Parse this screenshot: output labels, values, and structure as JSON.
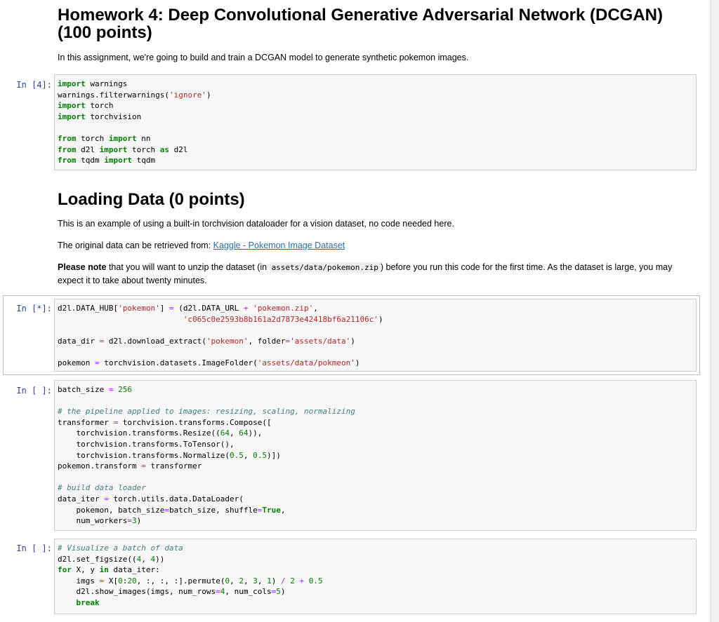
{
  "title": {
    "heading": "Homework 4: Deep Convolutional Generative Adversarial Network (DCGAN) (100 points)",
    "intro": "In this assignment, we're going to build and train a DCGAN model to generate synthetic pokemon images."
  },
  "loading": {
    "heading": "Loading Data (0 points)",
    "p1": "This is an example of using a built-in torchvision dataloader for a vision dataset, no code needed here.",
    "p2_prefix": "The original data can be retrieved from: ",
    "p2_link": "Kaggle - Pokemon Image Dataset",
    "p3_bold": "Please note",
    "p3_a": " that you will want to unzip the dataset (in ",
    "p3_code": "assets/data/pokemon.zip",
    "p3_b": ") before you run this code for the first time. As the dataset is large, you may expect it to take about twenty minutes."
  },
  "cells": [
    {
      "prompt": "In [4]:",
      "lines": [
        [
          [
            "kw",
            "import"
          ],
          [
            "t",
            " warnings"
          ]
        ],
        [
          [
            "t",
            "warnings.filterwarnings("
          ],
          [
            "st",
            "'ignore'"
          ],
          [
            "t",
            ")"
          ]
        ],
        [
          [
            "kw",
            "import"
          ],
          [
            "t",
            " torch"
          ]
        ],
        [
          [
            "kw",
            "import"
          ],
          [
            "t",
            " torchvision"
          ]
        ],
        [],
        [
          [
            "kw",
            "from"
          ],
          [
            "t",
            " torch "
          ],
          [
            "kw",
            "import"
          ],
          [
            "t",
            " nn"
          ]
        ],
        [
          [
            "kw",
            "from"
          ],
          [
            "t",
            " d2l "
          ],
          [
            "kw",
            "import"
          ],
          [
            "t",
            " torch "
          ],
          [
            "kw",
            "as"
          ],
          [
            "t",
            " d2l"
          ]
        ],
        [
          [
            "kw",
            "from"
          ],
          [
            "t",
            " tqdm "
          ],
          [
            "kw",
            "import"
          ],
          [
            "t",
            " tqdm"
          ]
        ]
      ]
    },
    {
      "prompt": "In [*]:",
      "lines": [
        [
          [
            "t",
            "d2l.DATA_HUB["
          ],
          [
            "st",
            "'pokemon'"
          ],
          [
            "t",
            "] "
          ],
          [
            "op",
            "="
          ],
          [
            "t",
            " (d2l.DATA_URL "
          ],
          [
            "op",
            "+"
          ],
          [
            "t",
            " "
          ],
          [
            "st",
            "'pokemon.zip'"
          ],
          [
            "t",
            ","
          ]
        ],
        [
          [
            "t",
            "                           "
          ],
          [
            "st",
            "'c065c0e2593b8b161a2d7873e42418bf6a21106c'"
          ],
          [
            "t",
            ")"
          ]
        ],
        [],
        [
          [
            "t",
            "data_dir "
          ],
          [
            "op",
            "="
          ],
          [
            "t",
            " d2l.download_extract("
          ],
          [
            "st",
            "'pokemon'"
          ],
          [
            "t",
            ", folder"
          ],
          [
            "op",
            "="
          ],
          [
            "st",
            "'assets/data'"
          ],
          [
            "t",
            ")"
          ]
        ],
        [],
        [
          [
            "t",
            "pokemon "
          ],
          [
            "op",
            "="
          ],
          [
            "t",
            " torchvision.datasets.ImageFolder("
          ],
          [
            "st",
            "'assets/data/pokmeon'"
          ],
          [
            "t",
            ")"
          ]
        ]
      ]
    },
    {
      "prompt": "In [ ]:",
      "lines": [
        [
          [
            "t",
            "batch_size "
          ],
          [
            "op",
            "="
          ],
          [
            "t",
            " "
          ],
          [
            "nu",
            "256"
          ]
        ],
        [],
        [
          [
            "cm",
            "# the pipeline applied to images: resizing, scaling, normalizing"
          ]
        ],
        [
          [
            "t",
            "transformer "
          ],
          [
            "op",
            "="
          ],
          [
            "t",
            " torchvision.transforms.Compose(["
          ]
        ],
        [
          [
            "t",
            "    torchvision.transforms.Resize(("
          ],
          [
            "nu",
            "64"
          ],
          [
            "t",
            ", "
          ],
          [
            "nu",
            "64"
          ],
          [
            "t",
            ")),"
          ]
        ],
        [
          [
            "t",
            "    torchvision.transforms.ToTensor(),"
          ]
        ],
        [
          [
            "t",
            "    torchvision.transforms.Normalize("
          ],
          [
            "nu",
            "0.5"
          ],
          [
            "t",
            ", "
          ],
          [
            "nu",
            "0.5"
          ],
          [
            "t",
            ")])"
          ]
        ],
        [
          [
            "t",
            "pokemon.transform "
          ],
          [
            "op",
            "="
          ],
          [
            "t",
            " transformer"
          ]
        ],
        [],
        [
          [
            "cm",
            "# build data loader"
          ]
        ],
        [
          [
            "t",
            "data_iter "
          ],
          [
            "op",
            "="
          ],
          [
            "t",
            " torch.utils.data.DataLoader("
          ]
        ],
        [
          [
            "t",
            "    pokemon, batch_size"
          ],
          [
            "op",
            "="
          ],
          [
            "t",
            "batch_size, shuffle"
          ],
          [
            "op",
            "="
          ],
          [
            "kw",
            "True"
          ],
          [
            "t",
            ","
          ]
        ],
        [
          [
            "t",
            "    num_workers"
          ],
          [
            "op",
            "="
          ],
          [
            "nu",
            "3"
          ],
          [
            "t",
            ")"
          ]
        ]
      ]
    },
    {
      "prompt": "In [ ]:",
      "lines": [
        [
          [
            "cm",
            "# Visualize a batch of data"
          ]
        ],
        [
          [
            "t",
            "d2l.set_figsize(("
          ],
          [
            "nu",
            "4"
          ],
          [
            "t",
            ", "
          ],
          [
            "nu",
            "4"
          ],
          [
            "t",
            "))"
          ]
        ],
        [
          [
            "kw",
            "for"
          ],
          [
            "t",
            " X, y "
          ],
          [
            "kw",
            "in"
          ],
          [
            "t",
            " data_iter:"
          ]
        ],
        [
          [
            "t",
            "    imgs "
          ],
          [
            "op",
            "="
          ],
          [
            "t",
            " X["
          ],
          [
            "nu",
            "0"
          ],
          [
            "t",
            ":"
          ],
          [
            "nu",
            "20"
          ],
          [
            "t",
            ", :, :, :].permute("
          ],
          [
            "nu",
            "0"
          ],
          [
            "t",
            ", "
          ],
          [
            "nu",
            "2"
          ],
          [
            "t",
            ", "
          ],
          [
            "nu",
            "3"
          ],
          [
            "t",
            ", "
          ],
          [
            "nu",
            "1"
          ],
          [
            "t",
            ") "
          ],
          [
            "op",
            "/"
          ],
          [
            "t",
            " "
          ],
          [
            "nu",
            "2"
          ],
          [
            "t",
            " "
          ],
          [
            "op",
            "+"
          ],
          [
            "t",
            " "
          ],
          [
            "nu",
            "0.5"
          ]
        ],
        [
          [
            "t",
            "    d2l.show_images(imgs, num_rows"
          ],
          [
            "op",
            "="
          ],
          [
            "nu",
            "4"
          ],
          [
            "t",
            ", num_cols"
          ],
          [
            "op",
            "="
          ],
          [
            "nu",
            "5"
          ],
          [
            "t",
            ")"
          ]
        ],
        [
          [
            "t",
            "    "
          ],
          [
            "kw",
            "break"
          ]
        ]
      ]
    }
  ]
}
